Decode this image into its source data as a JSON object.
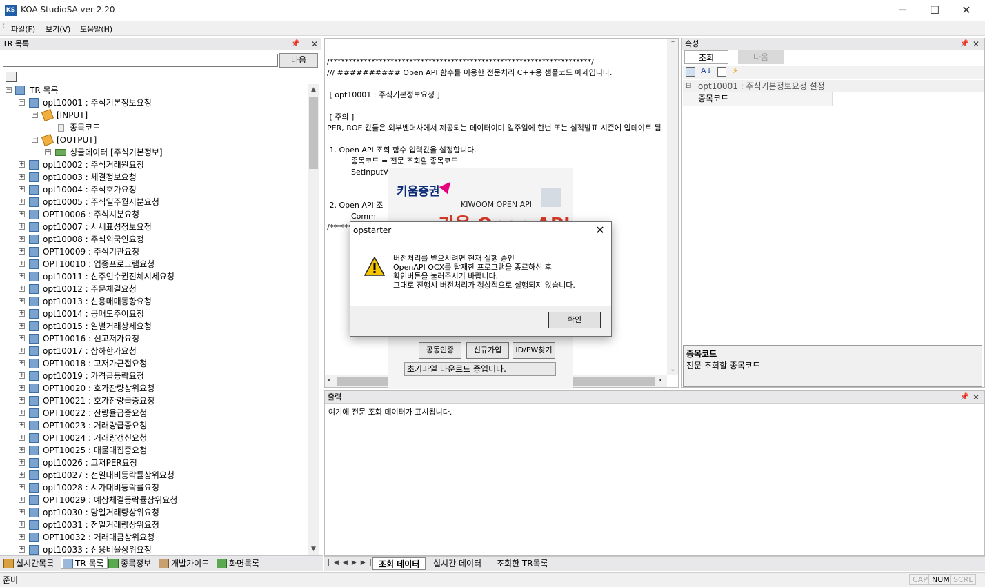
{
  "window": {
    "title": "KOA StudioSA ver 2.20",
    "app_icon": "KS"
  },
  "menu": [
    {
      "label": "파일(F)"
    },
    {
      "label": "보기(V)"
    },
    {
      "label": "도움말(H)"
    }
  ],
  "tr_panel": {
    "title": "TR 목록",
    "search_value": "",
    "next_label": "다음",
    "tree": {
      "root": "TR 목록",
      "selected": "opt10001 : 주식기본정보요청",
      "input_group": "[INPUT]",
      "input_field": "종목코드",
      "output_group": "[OUTPUT]",
      "output_item": "싱글데이터 [주식기본정보]",
      "items": [
        "opt10002 : 주식거래원요청",
        "opt10003 : 체결정보요청",
        "opt10004 : 주식호가요청",
        "opt10005 : 주식일주월시분요청",
        "OPT10006 : 주식시분요청",
        "opt10007 : 시세표성정보요청",
        "opt10008 : 주식외국인요청",
        "OPT10009 : 주식기관요청",
        "OPT10010 : 업종프로그램요청",
        "opt10011 : 신주인수권전체시세요청",
        "opt10012 : 주문체결요청",
        "opt10013 : 신용매매동향요청",
        "opt10014 : 공매도추이요청",
        "opt10015 : 일별거래상세요청",
        "OPT10016 : 신고저가요청",
        "opt10017 : 상하한가요청",
        "OPT10018 : 고저가근접요청",
        "opt10019 : 가격급등락요청",
        "OPT10020 : 호가잔량상위요청",
        "OPT10021 : 호가잔량급증요청",
        "OPT10022 : 잔량율급증요청",
        "OPT10023 : 거래량급증요청",
        "OPT10024 : 거래량갱신요청",
        "OPT10025 : 매물대집중요청",
        "opt10026 : 고저PER요청",
        "opt10027 : 전일대비등락률상위요청",
        "opt10028 : 시가대비등락률요청",
        "OPT10029 : 예상체결등락률상위요청",
        "opt10030 : 당일거래량상위요청",
        "opt10031 : 전일거래량상위요청",
        "OPT10032 : 거래대금상위요청",
        "opt10033 : 신용비율상위요청"
      ]
    },
    "bottom_tabs": [
      {
        "label": "실시간목록"
      },
      {
        "label": "TR 목록"
      },
      {
        "label": "종목정보"
      },
      {
        "label": "개발가이드"
      },
      {
        "label": "화면목록"
      }
    ]
  },
  "code": {
    "lines": [
      "/*********************************************************************/",
      "/// ########## Open API 함수를 이용한 전문처리 C++용 샘플코드 예제입니다.",
      "",
      " [ opt10001 : 주식기본정보요청 ]",
      "",
      " [ 주의 ]",
      "PER, ROE 값들은 외부벤더사에서 제공되는 데이터이며 일주일에 한번 또는 실적발표 시즌에 업데이트 됨",
      "",
      " 1. Open API 조회 함수 입력값을 설정합니다.",
      "          종목코드 = 전문 조회할 종목코드",
      "          SetInputValue(\"종목코드\"        ,  \"입력값 1\");",
      "",
      "",
      " 2. Open API 조                                              \")      ,  \"화면번호\");",
      "          Comm",
      "/************                                       ******************/"
    ]
  },
  "splash": {
    "brand": "키움증권",
    "subtitle": "KIWOOM OPEN API",
    "big_text": "키움 Open API",
    "buttons": [
      "공동인증",
      "신규가입",
      "ID/PW찾기"
    ],
    "status": "초기파일 다운로드 중입니다."
  },
  "properties": {
    "title": "속성",
    "tabs": [
      "조회",
      "다음"
    ],
    "category": "opt10001 : 주식기본정보요청 설정",
    "row_name": "종목코드",
    "row_value": "",
    "desc_title": "종목코드",
    "desc_text": "전문 조회할 종목코드"
  },
  "output": {
    "title": "출력",
    "text": "여기에 전문 조회 데이터가 표시됩니다.",
    "tabs": [
      "조회 데이터",
      "실시간 데이터",
      "조회한 TR목록"
    ]
  },
  "status": {
    "text": "준비",
    "indicators": [
      "CAP",
      "NUM",
      "SCRL"
    ]
  },
  "dialog": {
    "title": "opstarter",
    "message": "버전처리를 받으시려면 현재 실행 중인\nOpenAPI OCX를 탑재한 프로그램을 종료하신 후\n확인버튼을 눌러주시기 바랍니다.\n그대로 진행시 버전처리가 정상적으로 실행되지 않습니다.",
    "ok_label": "확인",
    "icon": "warning-icon"
  },
  "colors": {
    "accent": "#1f5fa8",
    "brand": "#e6007e",
    "warning": "#f5c400"
  }
}
